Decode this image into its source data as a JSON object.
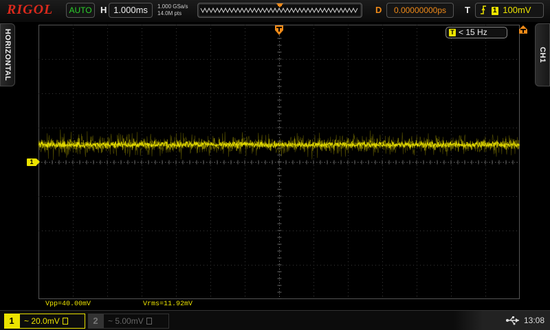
{
  "brand": "RIGOL",
  "header": {
    "run_mode": "AUTO",
    "horizontal_label": "H",
    "timebase": "1.000ms",
    "sample_rate": "1.000 GSa/s",
    "memory_depth": "14.0M pts",
    "delay_label": "D",
    "delay_value": "0.00000000ps",
    "trigger_label": "T",
    "trigger_channel": "1",
    "trigger_level": "100mV"
  },
  "side_tabs": {
    "left": "HORIZONTAL",
    "right": "CH1"
  },
  "trigger_badge": {
    "chip": "T",
    "text": "< 15 Hz"
  },
  "channel_marker": "1",
  "measurements": {
    "vpp": "Vpp=40.00mV",
    "vrms": "Vrms=11.92mV"
  },
  "channels": [
    {
      "number": "1",
      "coupling": "~",
      "scale": "20.0mV",
      "active": true
    },
    {
      "number": "2",
      "coupling": "~",
      "scale": "5.00mV",
      "active": false
    }
  ],
  "status": {
    "clock": "13:08"
  },
  "colors": {
    "ch1": "#ece300",
    "accent_orange": "#f08a18",
    "mode_green": "#2bd12b",
    "grid": "#3a3a3a",
    "brand_red": "#d9291c"
  },
  "icons": [
    "usb-icon",
    "trigger-edge-icon",
    "trigger-position-icon",
    "trigger-level-icon"
  ]
}
